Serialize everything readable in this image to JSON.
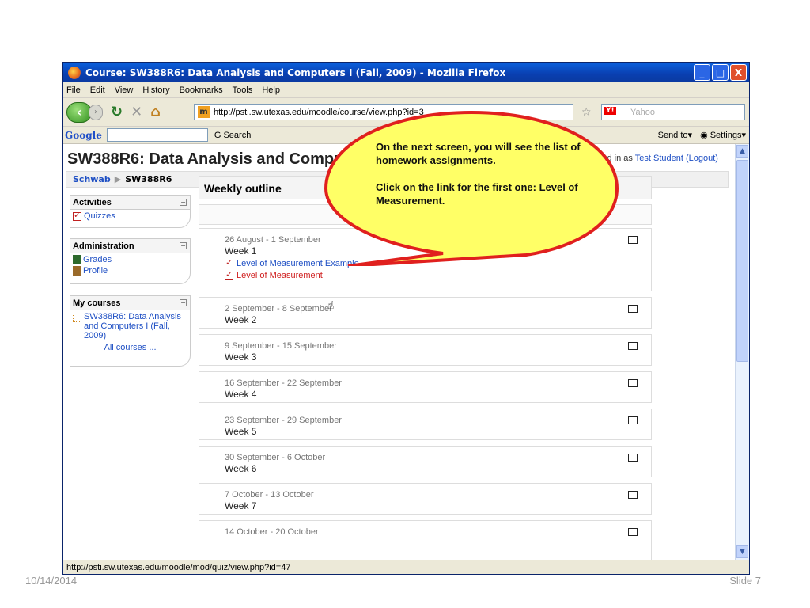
{
  "window": {
    "title": "Course: SW388R6: Data Analysis and Computers I (Fall, 2009) - Mozilla Firefox",
    "controls": [
      "_",
      "□",
      "X"
    ]
  },
  "menu": [
    "File",
    "Edit",
    "View",
    "History",
    "Bookmarks",
    "Tools",
    "Help"
  ],
  "nav": {
    "url": "http://psti.sw.utexas.edu/moodle/course/view.php?id=3",
    "search_placeholder": "Yahoo"
  },
  "googlebar": {
    "logo": "Google",
    "search_label": "Search",
    "send_to": "Send to",
    "settings": "Settings"
  },
  "page": {
    "title": "SW388R6: Data Analysis and Computers I (Fall, 2009)",
    "logged_prefix": "You are logged in as",
    "logged_user": "Test Student",
    "logout": "(Logout)",
    "breadcrumb": [
      "Schwab",
      "SW388R6"
    ]
  },
  "blocks": {
    "activities": {
      "title": "Activities",
      "items": [
        "Quizzes"
      ]
    },
    "administration": {
      "title": "Administration",
      "items": [
        "Grades",
        "Profile"
      ]
    },
    "my_courses": {
      "title": "My courses",
      "items": [
        "SW388R6: Data Analysis and Computers I (Fall, 2009)"
      ],
      "all": "All courses ..."
    }
  },
  "main": {
    "heading": "Weekly outline",
    "weeks": [
      {
        "date": "26 August - 1 September",
        "name": "Week 1",
        "links": [
          "Level of Measurement Example",
          "Level of Measurement"
        ]
      },
      {
        "date": "2 September - 8 September",
        "name": "Week 2"
      },
      {
        "date": "9 September - 15 September",
        "name": "Week 3"
      },
      {
        "date": "16 September - 22 September",
        "name": "Week 4"
      },
      {
        "date": "23 September - 29 September",
        "name": "Week 5"
      },
      {
        "date": "30 September - 6 October",
        "name": "Week 6"
      },
      {
        "date": "7 October - 13 October",
        "name": "Week 7"
      },
      {
        "date": "14 October - 20 October",
        "name": ""
      }
    ]
  },
  "callout": {
    "line1": "On the next screen, you will see the list of homework assignments.",
    "line2": "Click on the link for the first one: Level of Measurement.",
    "border_color": "#e0201e",
    "fill_color": "#ffff66"
  },
  "status": {
    "text": "http://psti.sw.utexas.edu/moodle/mod/quiz/view.php?id=47"
  },
  "slide": {
    "date": "10/14/2014",
    "number": "Slide 7"
  }
}
